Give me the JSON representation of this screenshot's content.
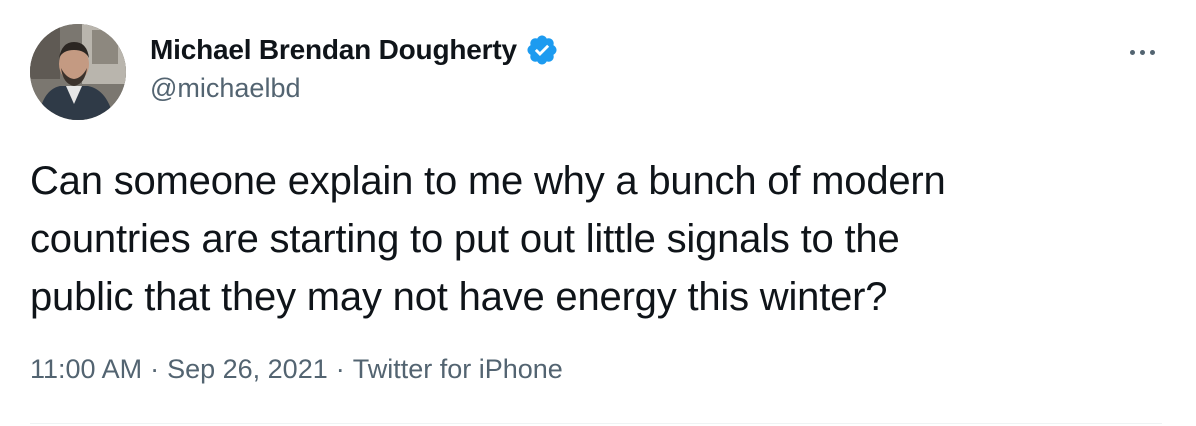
{
  "author": {
    "display_name": "Michael Brendan Dougherty",
    "handle": "@michaelbd",
    "verified": true,
    "avatar_icon": "profile-photo",
    "verified_icon": "verified-badge-icon",
    "verified_color": "#1d9bf0"
  },
  "menu": {
    "icon": "more-options-icon"
  },
  "tweet": {
    "text": "Can someone explain to me why a bunch of modern\ncountries are starting to put out little signals to the\npublic that they may not have energy this winter?"
  },
  "meta": {
    "time": "11:00 AM",
    "date": "Sep 26, 2021",
    "separator": "·",
    "source": "Twitter for iPhone"
  },
  "colors": {
    "text_primary": "#0f1419",
    "text_secondary": "#536471",
    "divider": "#eff3f4"
  }
}
